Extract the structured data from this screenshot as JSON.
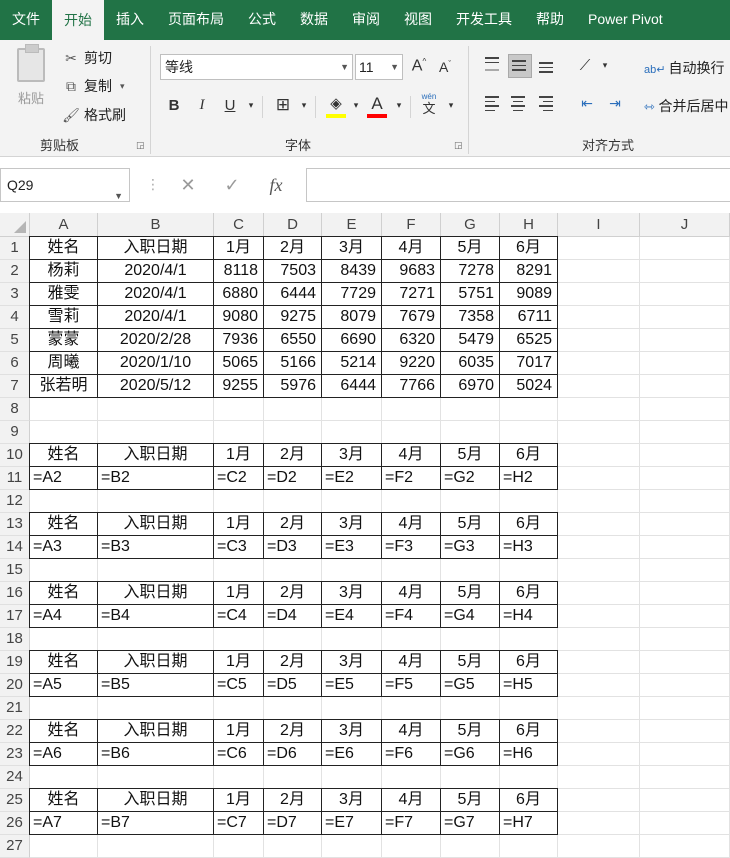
{
  "tabs": [
    "文件",
    "开始",
    "插入",
    "页面布局",
    "公式",
    "数据",
    "审阅",
    "视图",
    "开发工具",
    "帮助",
    "Power Pivot"
  ],
  "active_tab_index": 1,
  "ribbon": {
    "paste_label": "粘贴",
    "cut_label": "剪切",
    "copy_label": "复制",
    "format_painter_label": "格式刷",
    "clipboard_group": "剪贴板",
    "font_name": "等线",
    "font_size": "11",
    "font_group": "字体",
    "wrap_text_label": "自动换行",
    "merge_center_label": "合并后居中",
    "alignment_group": "对齐方式",
    "bold": "B",
    "italic": "I",
    "underline": "U",
    "grow_font": "A",
    "shrink_font": "A",
    "font_color_glyph": "A",
    "phonetic_glyph": "文",
    "phonetic_small": "wén",
    "highlight_color": "#ffff00",
    "font_color": "#ff0000"
  },
  "formula_bar": {
    "name_box": "Q29",
    "cancel_glyph": "✕",
    "enter_glyph": "✓",
    "fx_glyph": "fx",
    "formula": ""
  },
  "columns": [
    "A",
    "B",
    "C",
    "D",
    "E",
    "F",
    "G",
    "H",
    "I",
    "J"
  ],
  "rows": [
    [
      "姓名",
      "入职日期",
      "1月",
      "2月",
      "3月",
      "4月",
      "5月",
      "6月"
    ],
    [
      "杨莉",
      "2020/4/1",
      "8118",
      "7503",
      "8439",
      "9683",
      "7278",
      "8291"
    ],
    [
      "雅雯",
      "2020/4/1",
      "6880",
      "6444",
      "7729",
      "7271",
      "5751",
      "9089"
    ],
    [
      "雪莉",
      "2020/4/1",
      "9080",
      "9275",
      "8079",
      "7679",
      "7358",
      "6711"
    ],
    [
      "蒙蒙",
      "2020/2/28",
      "7936",
      "6550",
      "6690",
      "6320",
      "5479",
      "6525"
    ],
    [
      "周曦",
      "2020/1/10",
      "5065",
      "5166",
      "5214",
      "9220",
      "6035",
      "7017"
    ],
    [
      "张若明",
      "2020/5/12",
      "9255",
      "5976",
      "6444",
      "7766",
      "6970",
      "5024"
    ],
    [],
    [],
    [
      "姓名",
      "入职日期",
      "1月",
      "2月",
      "3月",
      "4月",
      "5月",
      "6月"
    ],
    [
      "=A2",
      "=B2",
      "=C2",
      "=D2",
      "=E2",
      "=F2",
      "=G2",
      "=H2"
    ],
    [],
    [
      "姓名",
      "入职日期",
      "1月",
      "2月",
      "3月",
      "4月",
      "5月",
      "6月"
    ],
    [
      "=A3",
      "=B3",
      "=C3",
      "=D3",
      "=E3",
      "=F3",
      "=G3",
      "=H3"
    ],
    [],
    [
      "姓名",
      "入职日期",
      "1月",
      "2月",
      "3月",
      "4月",
      "5月",
      "6月"
    ],
    [
      "=A4",
      "=B4",
      "=C4",
      "=D4",
      "=E4",
      "=F4",
      "=G4",
      "=H4"
    ],
    [],
    [
      "姓名",
      "入职日期",
      "1月",
      "2月",
      "3月",
      "4月",
      "5月",
      "6月"
    ],
    [
      "=A5",
      "=B5",
      "=C5",
      "=D5",
      "=E5",
      "=F5",
      "=G5",
      "=H5"
    ],
    [],
    [
      "姓名",
      "入职日期",
      "1月",
      "2月",
      "3月",
      "4月",
      "5月",
      "6月"
    ],
    [
      "=A6",
      "=B6",
      "=C6",
      "=D6",
      "=E6",
      "=F6",
      "=G6",
      "=H6"
    ],
    [],
    [
      "姓名",
      "入职日期",
      "1月",
      "2月",
      "3月",
      "4月",
      "5月",
      "6月"
    ],
    [
      "=A7",
      "=B7",
      "=C7",
      "=D7",
      "=E7",
      "=F7",
      "=G7",
      "=H7"
    ],
    []
  ],
  "row_numbers": [
    "1",
    "2",
    "3",
    "4",
    "5",
    "6",
    "7",
    "8",
    "9",
    "10",
    "11",
    "12",
    "13",
    "14",
    "15",
    "16",
    "17",
    "18",
    "19",
    "20",
    "21",
    "22",
    "23",
    "24",
    "25",
    "26",
    "27"
  ]
}
